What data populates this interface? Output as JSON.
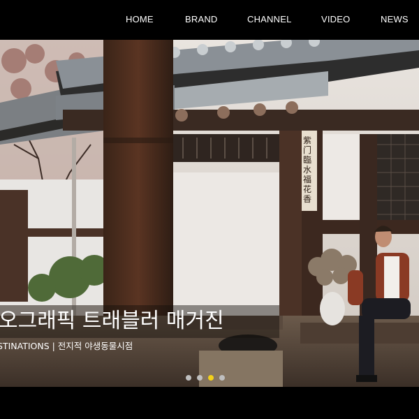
{
  "nav": {
    "items": [
      {
        "label": "HOME"
      },
      {
        "label": "BRAND"
      },
      {
        "label": "CHANNEL"
      },
      {
        "label": "VIDEO"
      },
      {
        "label": "NEWS"
      }
    ]
  },
  "hero": {
    "title": "오그래픽 트래블러 매거진",
    "subtitle": "STINATIONS | 전지적 야생동물시점",
    "plaque_text": "紫门臨水福花香",
    "slider": {
      "total": 4,
      "active": 3
    },
    "colors": {
      "active_dot": "#f3d11a",
      "inactive_dot": "#bfbfbf"
    }
  }
}
